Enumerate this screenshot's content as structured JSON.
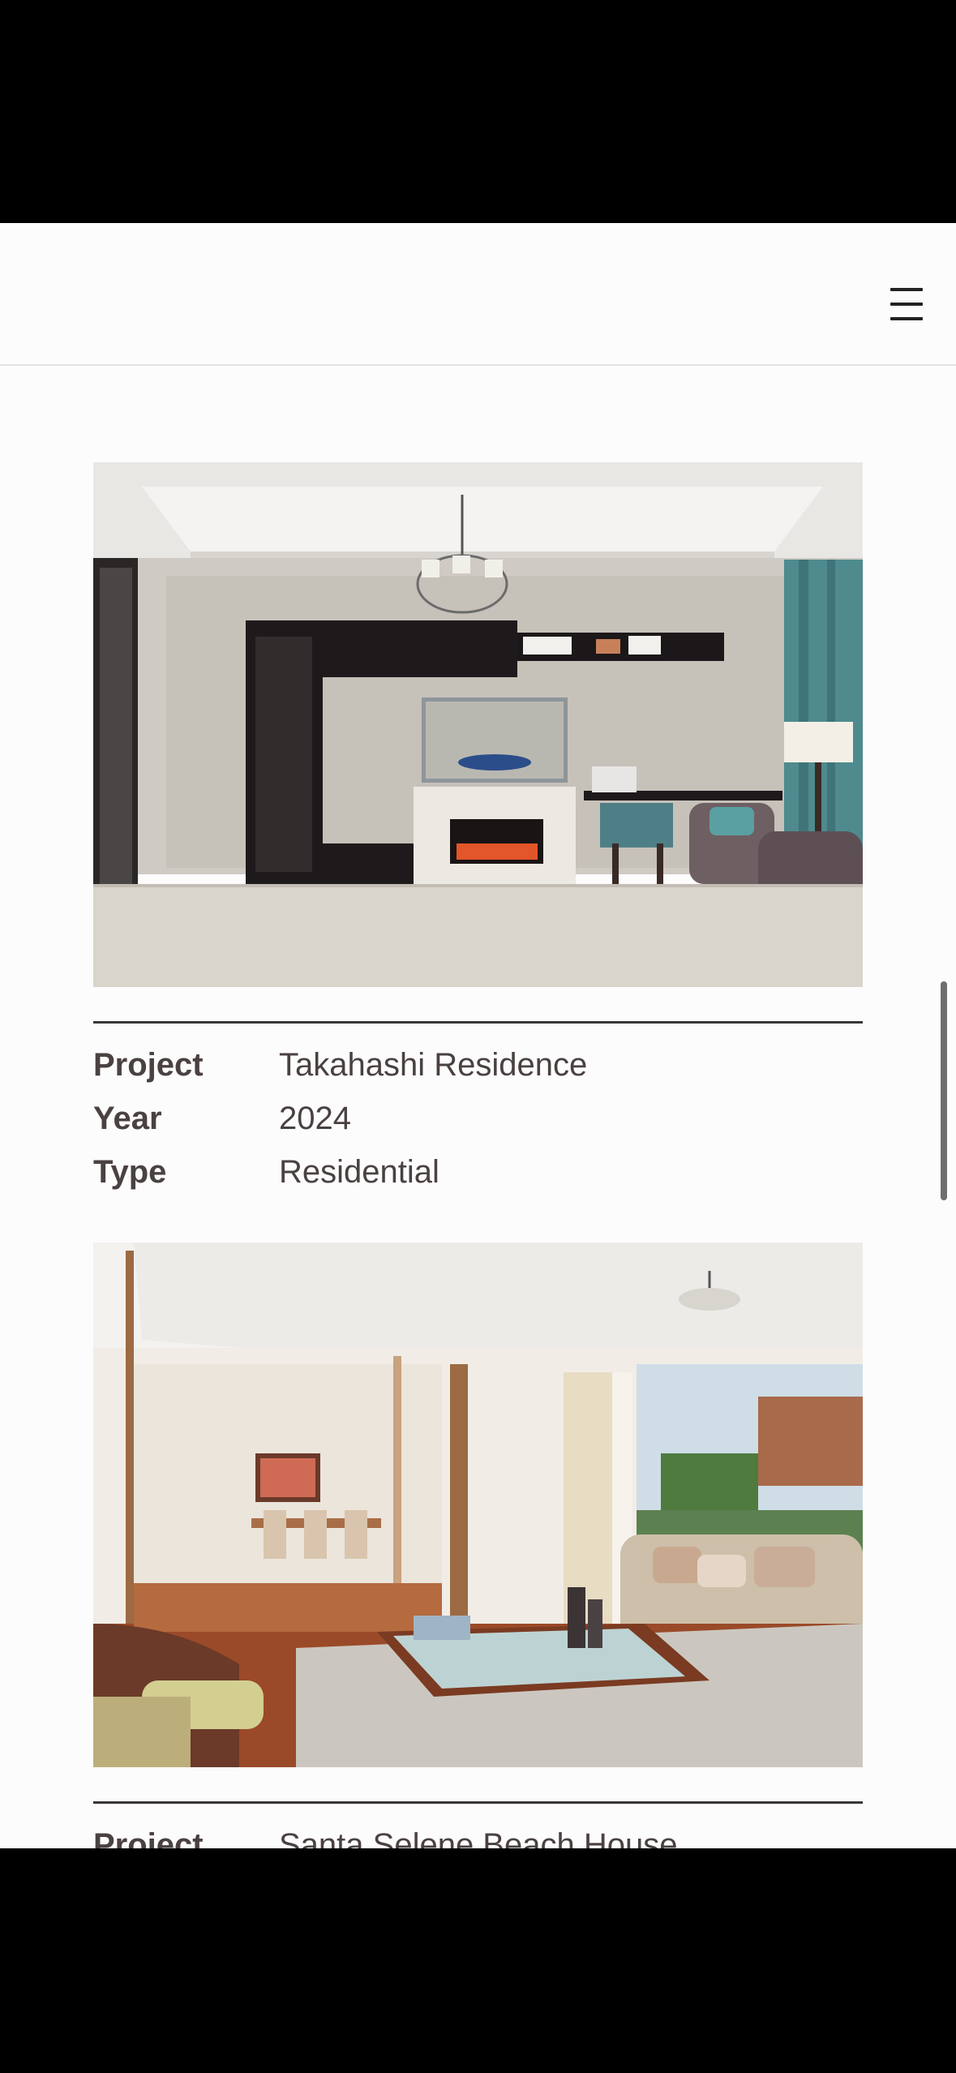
{
  "header": {
    "menu_icon": "hamburger-menu-icon"
  },
  "projects": [
    {
      "image_icon": "living-room-fireplace-photo",
      "project_label": "Project",
      "project_value": "Takahashi Residence",
      "year_label": "Year",
      "year_value": "2024",
      "type_label": "Type",
      "type_value": "Residential"
    },
    {
      "image_icon": "living-room-dining-photo",
      "project_label": "Project",
      "project_value": "Santa Selene Beach House"
    }
  ],
  "colors": {
    "page_background": "#fdfcfc",
    "text": "#4a4141",
    "divider": "#3a3636",
    "accent_curtain": "#4e8a8e"
  }
}
